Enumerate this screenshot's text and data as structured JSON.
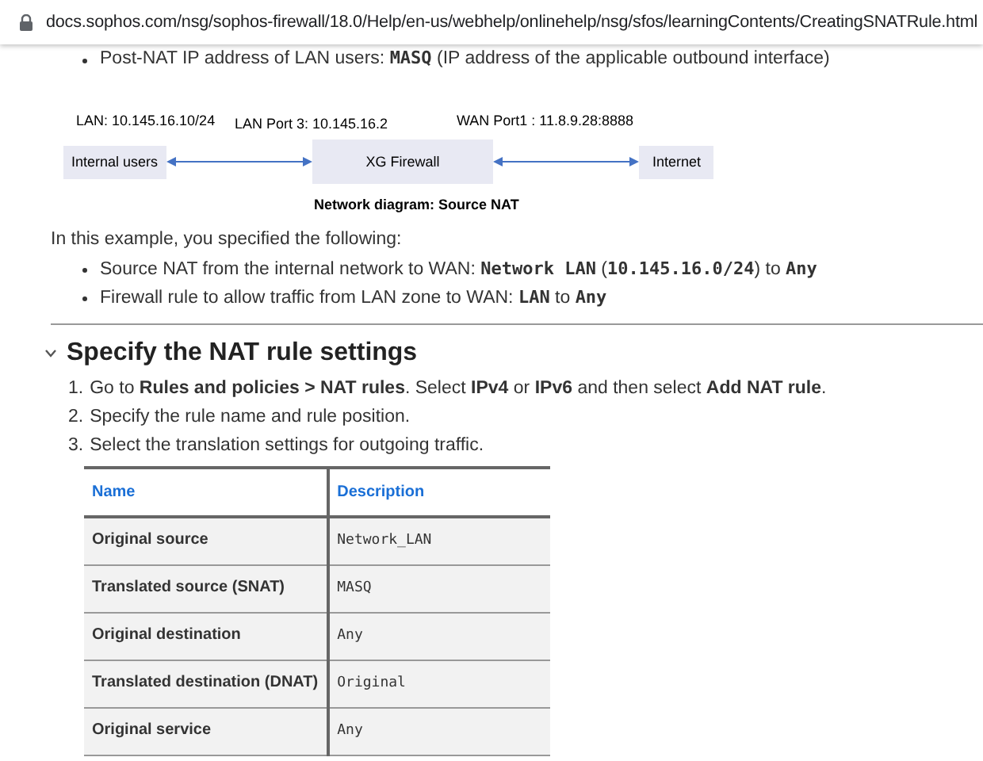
{
  "address_bar": {
    "url": "docs.sophos.com/nsg/sophos-firewall/18.0/Help/en-us/webhelp/onlinehelp/nsg/sfos/learningContents/CreatingSNATRule.html"
  },
  "top_bullets": [
    [
      {
        "kind": "text",
        "text": "Post-NAT IP address of LAN users: "
      },
      {
        "kind": "code",
        "text": "MASQ"
      },
      {
        "kind": "text",
        "text": " (IP address of the applicable outbound interface)"
      }
    ]
  ],
  "diagram": {
    "lan_label": "LAN: 10.145.16.10/24",
    "lan_port_label": "LAN Port 3: 10.145.16.2",
    "wan_port_label": "WAN Port1 : 11.8.9.28:8888",
    "nodes": [
      "Internal users",
      "XG Firewall",
      "Internet"
    ],
    "caption": "Network diagram: Source NAT"
  },
  "intro": "In this example, you specified the following:",
  "bullets": [
    [
      {
        "kind": "text",
        "text": "Source NAT from the internal network to WAN: "
      },
      {
        "kind": "code",
        "text": "Network LAN"
      },
      {
        "kind": "text",
        "text": " ("
      },
      {
        "kind": "code",
        "text": "10.145.16.0/24"
      },
      {
        "kind": "text",
        "text": ") to "
      },
      {
        "kind": "code",
        "text": "Any"
      }
    ],
    [
      {
        "kind": "text",
        "text": "Firewall rule to allow traffic from LAN zone to WAN: "
      },
      {
        "kind": "code",
        "text": "LAN"
      },
      {
        "kind": "text",
        "text": " to "
      },
      {
        "kind": "code",
        "text": "Any"
      }
    ]
  ],
  "section": {
    "title": "Specify the NAT rule settings",
    "expanded": true
  },
  "steps": [
    {
      "number": "1.",
      "text": "Go to **Rules and policies > NAT rules**. Select **IPv4** or **IPv6** and then select **Add NAT rule**."
    },
    {
      "number": "2.",
      "text": "Specify the rule name and rule position."
    },
    {
      "number": "3.",
      "text": "Select the translation settings for outgoing traffic."
    }
  ],
  "table": {
    "columns": [
      "Name",
      "Description"
    ],
    "rows": [
      [
        "Original source",
        "Network_LAN"
      ],
      [
        "Translated source (SNAT)",
        "MASQ"
      ],
      [
        "Original destination",
        "Any"
      ],
      [
        "Translated destination (DNAT)",
        "Original"
      ],
      [
        "Original service",
        "Any"
      ]
    ]
  }
}
